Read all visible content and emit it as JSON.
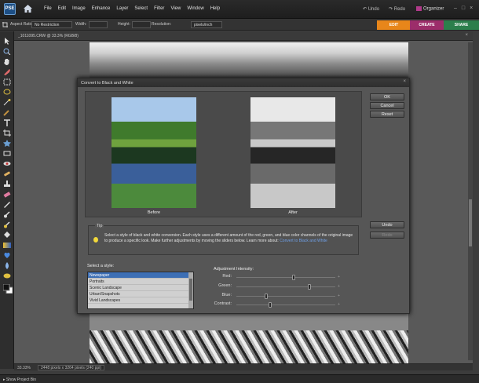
{
  "app": {
    "logo": "PSE"
  },
  "menubar": {
    "items": [
      "File",
      "Edit",
      "Image",
      "Enhance",
      "Layer",
      "Select",
      "Filter",
      "View",
      "Window",
      "Help"
    ],
    "undo": "Undo",
    "redo": "Redo",
    "organizer": "Organizer",
    "window_buttons": [
      "–",
      "□",
      "×"
    ]
  },
  "options_bar": {
    "aspect_label": "Aspect Ratio:",
    "aspect_value": "No Restriction",
    "width_label": "Width:",
    "height_label": "Height:",
    "resolution_label": "Resolution:",
    "resolution_unit": "pixels/inch"
  },
  "mode_tabs": {
    "edit": "EDIT",
    "create": "CREATE",
    "share": "SHARE"
  },
  "document": {
    "title": "_1011095.CRW @ 33.3% (RGB/8)",
    "close": "×",
    "zoom": "33.33%",
    "info": "2448 pixels x 3264 pixels (240 ppi)"
  },
  "bottom_bar": {
    "project_bin": "Show Project Bin"
  },
  "dialog": {
    "title": "Convert to Black and White",
    "close": "×",
    "before_label": "Before",
    "after_label": "After",
    "buttons": {
      "ok": "OK",
      "cancel": "Cancel",
      "reset": "Reset",
      "undo": "Undo",
      "redo": "Redo"
    },
    "tip": {
      "title": "Tip",
      "text": "Select a style of black and white conversion. Each style uses a different amount of the red, green, and blue color channels of the original image to produce a specific look. Make further adjustments by moving the sliders below. Learn more about:",
      "link": "Convert to Black and White"
    },
    "style_label": "Select a style:",
    "styles": [
      {
        "name": "Newspaper",
        "selected": true
      },
      {
        "name": "Portraits",
        "selected": false
      },
      {
        "name": "Scenic Landscape",
        "selected": false
      },
      {
        "name": "Urban/Snapshots",
        "selected": false
      },
      {
        "name": "Vivid Landscapes",
        "selected": false
      }
    ],
    "adjustment_label": "Adjustment Intensity:",
    "sliders": [
      {
        "label": "Red:",
        "value": 0.58
      },
      {
        "label": "Green:",
        "value": 0.74
      },
      {
        "label": "Blue:",
        "value": 0.3
      },
      {
        "label": "Contrast:",
        "value": 0.34
      }
    ],
    "slider_minus": "–",
    "slider_plus": "+"
  },
  "colors": {
    "edit_tab": "#e8861a",
    "create_tab": "#9c2d6a",
    "share_tab": "#2c7f4c",
    "selection": "#3d6fb5",
    "link": "#6fa0e8"
  }
}
